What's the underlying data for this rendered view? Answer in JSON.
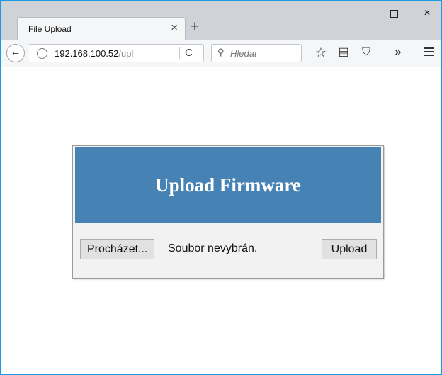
{
  "browser": {
    "tab_title": "File Upload",
    "tab_close_glyph": "×",
    "new_tab_glyph": "+",
    "window_close_glyph": "×",
    "back_glyph": "←",
    "info_glyph": "i",
    "url_host": "192.168.100.52",
    "url_path": "/upl",
    "reload_glyph": "C",
    "search_glyph": "⚲",
    "search_placeholder": "Hledat",
    "star_glyph": "☆",
    "reader_glyph": "▤",
    "pocket_glyph": "⛉",
    "overflow_glyph": "»",
    "accent_color": "#1a9ae0"
  },
  "icons": [
    "back-icon",
    "info-icon",
    "reload-icon",
    "search-icon",
    "bookmark-star-icon",
    "reader-view-icon",
    "pocket-icon",
    "overflow-icon",
    "hamburger-menu-icon",
    "minimize-icon",
    "maximize-icon",
    "close-icon"
  ],
  "page": {
    "title": "Upload Firmware",
    "header_color": "#4682b4",
    "browse_label": "Procházet...",
    "file_status": "Soubor nevybrán.",
    "upload_label": "Upload"
  }
}
